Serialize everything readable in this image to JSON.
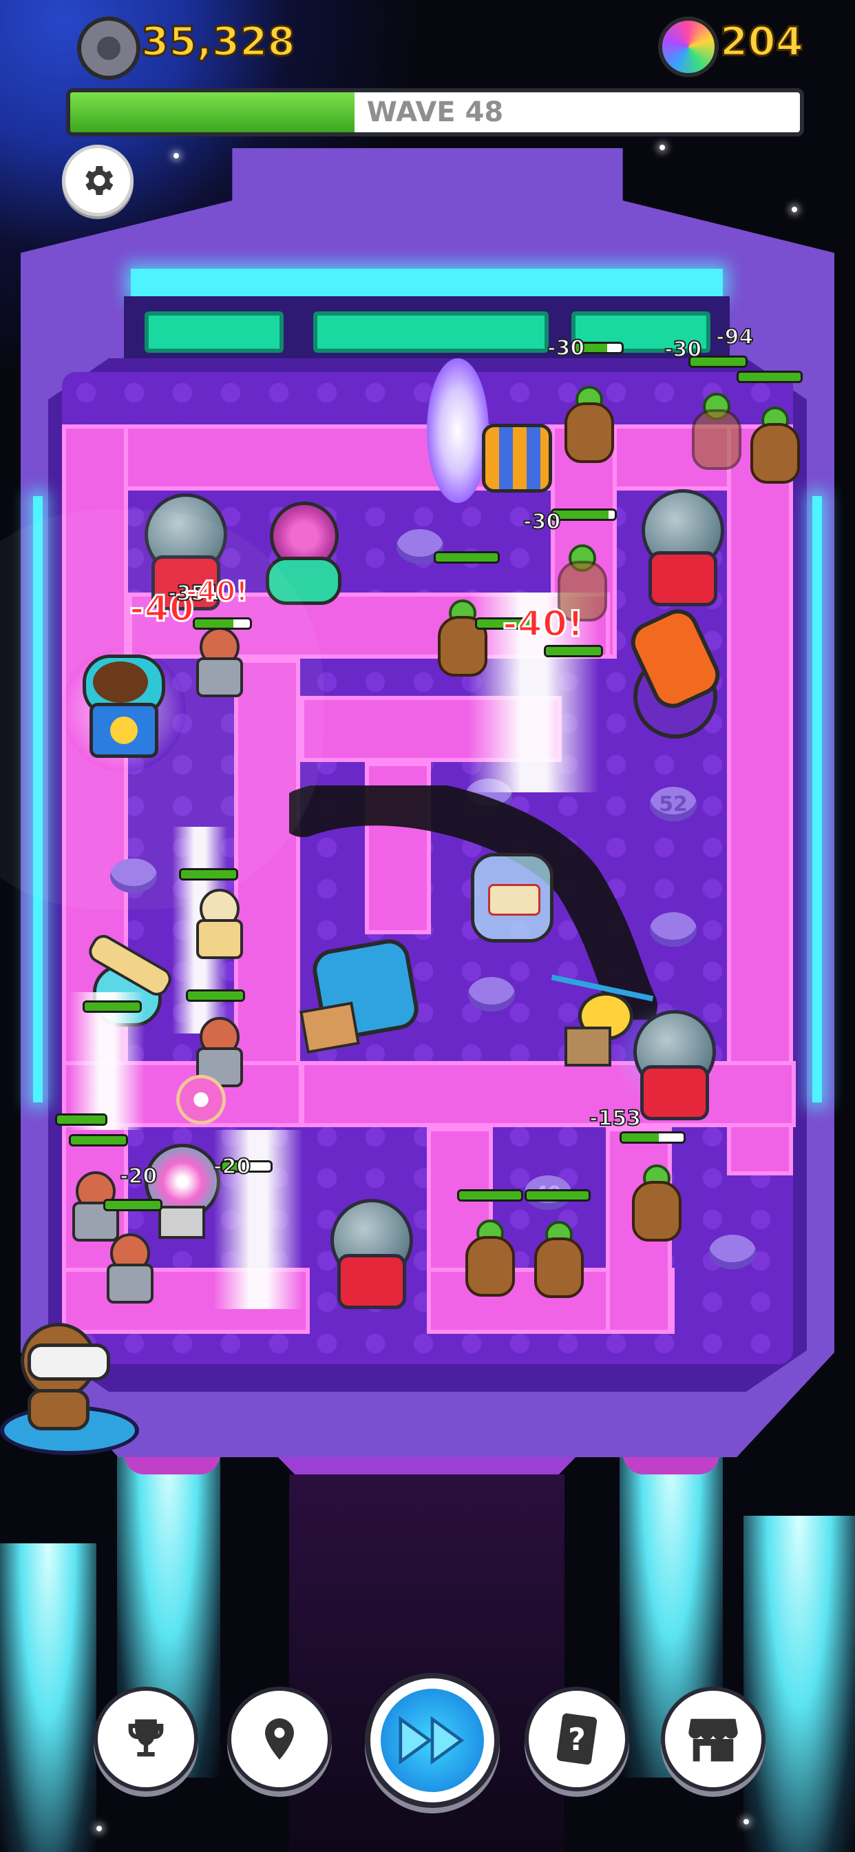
{
  "hud": {
    "coins": "35,328",
    "gems": "204",
    "coin_icon": "coin-reel-icon",
    "gem_icon": "rainbow-donut-icon"
  },
  "wave": {
    "label": "WAVE 48",
    "progress": 0.39
  },
  "board": {
    "slot_number": "52",
    "slot_number_2": "49",
    "damage_numbers": [
      "-30",
      "-30",
      "-94",
      "-30",
      "-40!",
      "-40",
      "-351",
      "-40!",
      "-153",
      "-20",
      "-20"
    ]
  },
  "nav": [
    {
      "label": "",
      "icon": "trophy-icon"
    },
    {
      "label": "",
      "icon": "map-pin-icon"
    },
    {
      "label": "",
      "icon": "fast-forward-icon"
    },
    {
      "label": "",
      "icon": "help-card-icon"
    },
    {
      "label": "",
      "icon": "shop-icon"
    }
  ],
  "colors": {
    "coin_text": "#ffd13a",
    "wave_fill": "#43b31c",
    "track_pink": "#f163e6",
    "floor_purple": "#6a28c8",
    "cyan_glow": "#4ff3ff"
  }
}
